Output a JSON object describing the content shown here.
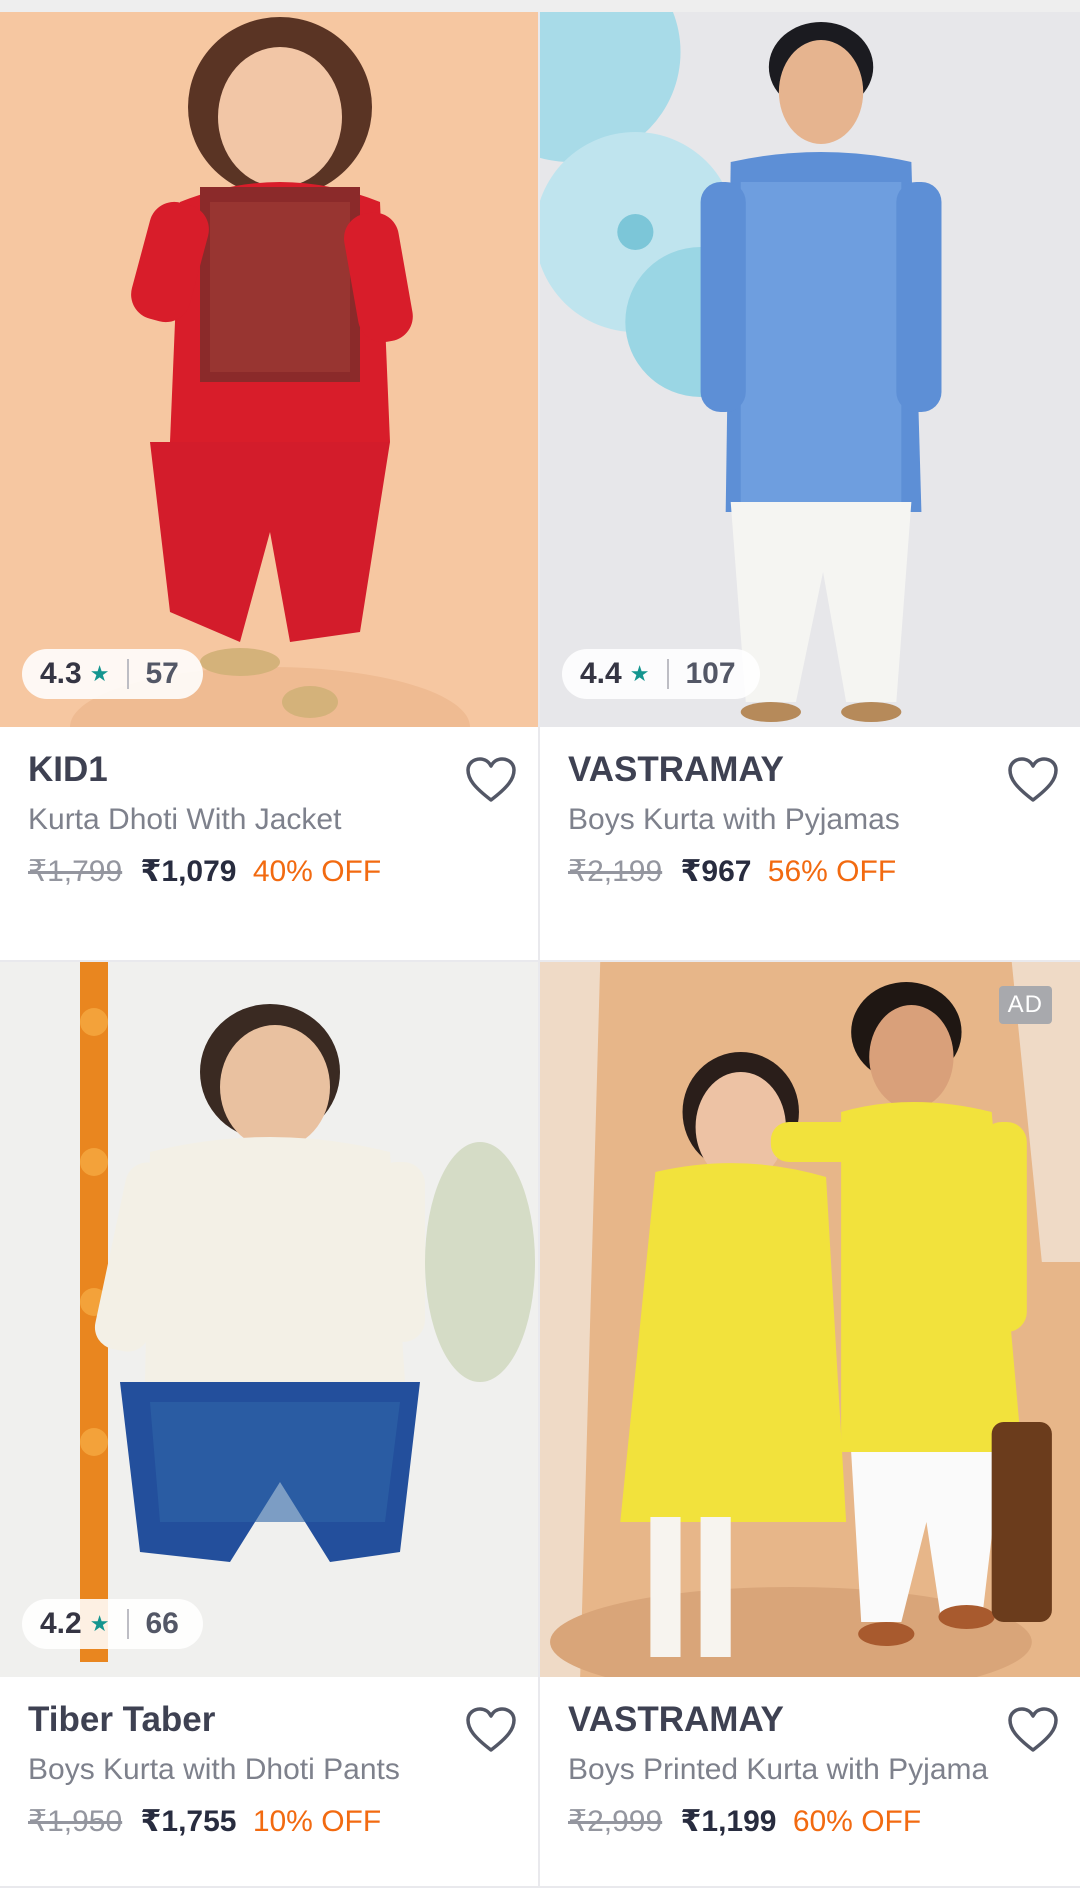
{
  "products": [
    {
      "brand": "KID1",
      "name": "Kurta Dhoti With Jacket",
      "mrp": "₹1,799",
      "price": "₹1,079",
      "discount": "40% OFF",
      "rating": "4.3",
      "rating_count": "57",
      "ad": ""
    },
    {
      "brand": "VASTRAMAY",
      "name": "Boys Kurta with Pyjamas",
      "mrp": "₹2,199",
      "price": "₹967",
      "discount": "56% OFF",
      "rating": "4.4",
      "rating_count": "107",
      "ad": ""
    },
    {
      "brand": "Tiber Taber",
      "name": "Boys Kurta with Dhoti Pants",
      "mrp": "₹1,950",
      "price": "₹1,755",
      "discount": "10% OFF",
      "rating": "4.2",
      "rating_count": "66",
      "ad": ""
    },
    {
      "brand": "VASTRAMAY",
      "name": "Boys Printed Kurta with Pyjama",
      "mrp": "₹2,999",
      "price": "₹1,199",
      "discount": "60% OFF",
      "rating": "",
      "rating_count": "",
      "ad": "AD"
    }
  ],
  "icons": {
    "star": "star-icon",
    "wishlist": "heart-outline-icon"
  },
  "colors": {
    "discount": "#f26a10",
    "star": "#14958f"
  }
}
